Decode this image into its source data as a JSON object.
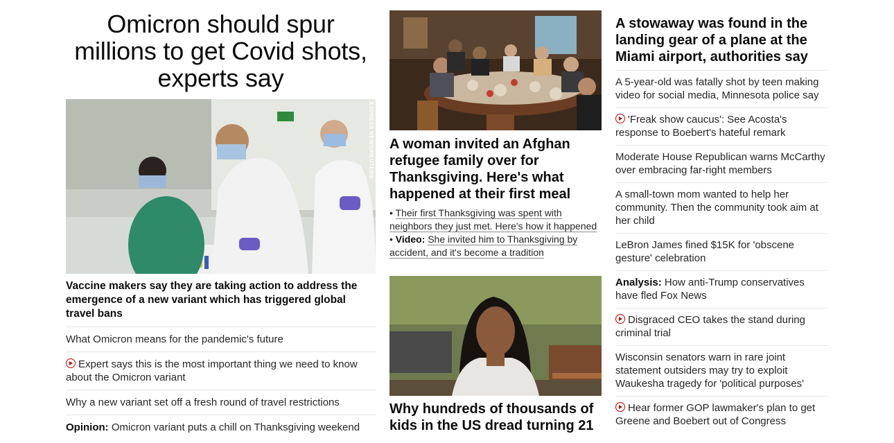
{
  "lead": {
    "title": "Omicron should spur millions to get Covid shots, experts say",
    "photo_credit": "EXPRESS NEWS/REUTERS",
    "subhead": "Vaccine makers say they are taking action to address the emergence of a new variant which has triggered global travel bans",
    "links": [
      {
        "prefix": "",
        "text": "What Omicron means for the pandemic's future",
        "video": false
      },
      {
        "prefix": "",
        "text": "Expert says this is the most important thing we need to know about the Omicron variant",
        "video": true
      },
      {
        "prefix": "",
        "text": "Why a new variant set off a fresh round of travel restrictions",
        "video": false
      },
      {
        "prefix": "Opinion:",
        "text": " Omicron variant puts a chill on Thanksgiving weekend",
        "video": false
      }
    ]
  },
  "middle": {
    "story1": {
      "title": "A woman invited an Afghan refugee family over for Thanksgiving. Here's what happened at their first meal",
      "bullet1": "Their first Thanksgiving was spent with neighbors they just met. Here's how it happened",
      "bullet2_prefix": "Video:",
      "bullet2": "She invited him to Thanksgiving by accident, and it's become a tradition"
    },
    "story2": {
      "title": "Why hundreds of thousands of kids in the US dread turning 21"
    }
  },
  "right": {
    "title": "A stowaway was found in the landing gear of a plane at the Miami airport, authorities say",
    "links": [
      {
        "prefix": "",
        "text": "A 5-year-old was fatally shot by teen making video for social media, Minnesota police say",
        "video": false
      },
      {
        "prefix": "",
        "text": "'Freak show caucus': See Acosta's response to Boebert's hateful remark",
        "video": true
      },
      {
        "prefix": "",
        "text": "Moderate House Republican warns McCarthy over embracing far-right members",
        "video": false
      },
      {
        "prefix": "",
        "text": "A small-town mom wanted to help her community. Then the community took aim at her child",
        "video": false
      },
      {
        "prefix": "",
        "text": "LeBron James fined $15K for 'obscene gesture' celebration",
        "video": false
      },
      {
        "prefix": "Analysis:",
        "text": " How anti-Trump conservatives have fled Fox News",
        "video": false
      },
      {
        "prefix": "",
        "text": "Disgraced CEO takes the stand during criminal trial",
        "video": true
      },
      {
        "prefix": "",
        "text": "Wisconsin senators warn in rare joint statement outsiders may try to exploit Waukesha tragedy for 'political purposes'",
        "video": false
      },
      {
        "prefix": "",
        "text": "Hear former GOP lawmaker's plan to get Greene and Boebert out of Congress",
        "video": true
      }
    ]
  },
  "colors": {
    "accent": "#cc0000",
    "text": "#0c0c0c",
    "divider": "#e6e6e6"
  }
}
